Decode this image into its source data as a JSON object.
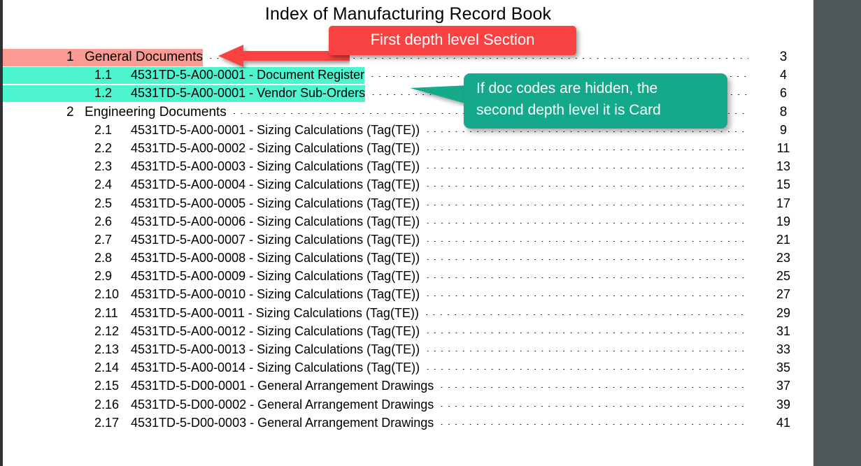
{
  "document": {
    "title": "Index of Manufacturing Record Book"
  },
  "toc": {
    "entries": [
      {
        "number": "1",
        "label": "General Documents",
        "page": "3",
        "level": 1,
        "highlight": "pink"
      },
      {
        "number": "1.1",
        "label": "4531TD-5-A00-0001 - Document Register",
        "page": "4",
        "level": 2,
        "highlight": "cyan"
      },
      {
        "number": "1.2",
        "label": "4531TD-5-A00-0001 - Vendor Sub-Orders",
        "page": "6",
        "level": 2,
        "highlight": "cyan"
      },
      {
        "number": "2",
        "label": "Engineering Documents",
        "page": "8",
        "level": 1,
        "highlight": "none"
      },
      {
        "number": "2.1",
        "label": "4531TD-5-A00-0001 - Sizing Calculations (Tag(TE))",
        "page": "9",
        "level": 2,
        "highlight": "none"
      },
      {
        "number": "2.2",
        "label": "4531TD-5-A00-0002 - Sizing Calculations (Tag(TE))",
        "page": "11",
        "level": 2,
        "highlight": "none"
      },
      {
        "number": "2.3",
        "label": "4531TD-5-A00-0003 - Sizing Calculations (Tag(TE))",
        "page": "13",
        "level": 2,
        "highlight": "none"
      },
      {
        "number": "2.4",
        "label": "4531TD-5-A00-0004 - Sizing Calculations (Tag(TE))",
        "page": "15",
        "level": 2,
        "highlight": "none"
      },
      {
        "number": "2.5",
        "label": "4531TD-5-A00-0005 - Sizing Calculations (Tag(TE))",
        "page": "17",
        "level": 2,
        "highlight": "none"
      },
      {
        "number": "2.6",
        "label": "4531TD-5-A00-0006 - Sizing Calculations (Tag(TE))",
        "page": "19",
        "level": 2,
        "highlight": "none"
      },
      {
        "number": "2.7",
        "label": "4531TD-5-A00-0007 - Sizing Calculations (Tag(TE))",
        "page": "21",
        "level": 2,
        "highlight": "none"
      },
      {
        "number": "2.8",
        "label": "4531TD-5-A00-0008 - Sizing Calculations (Tag(TE))",
        "page": "23",
        "level": 2,
        "highlight": "none"
      },
      {
        "number": "2.9",
        "label": "4531TD-5-A00-0009 - Sizing Calculations (Tag(TE))",
        "page": "25",
        "level": 2,
        "highlight": "none"
      },
      {
        "number": "2.10",
        "label": "4531TD-5-A00-0010 - Sizing Calculations (Tag(TE))",
        "page": "27",
        "level": 2,
        "highlight": "none"
      },
      {
        "number": "2.11",
        "label": "4531TD-5-A00-0011 - Sizing Calculations (Tag(TE))",
        "page": "29",
        "level": 2,
        "highlight": "none"
      },
      {
        "number": "2.12",
        "label": "4531TD-5-A00-0012 - Sizing Calculations (Tag(TE))",
        "page": "31",
        "level": 2,
        "highlight": "none"
      },
      {
        "number": "2.13",
        "label": "4531TD-5-A00-0013 - Sizing Calculations (Tag(TE))",
        "page": "33",
        "level": 2,
        "highlight": "none"
      },
      {
        "number": "2.14",
        "label": "4531TD-5-A00-0014 - Sizing Calculations (Tag(TE))",
        "page": "35",
        "level": 2,
        "highlight": "none"
      },
      {
        "number": "2.15",
        "label": "4531TD-5-D00-0001 - General Arrangement Drawings",
        "page": "37",
        "level": 2,
        "highlight": "none"
      },
      {
        "number": "2.16",
        "label": "4531TD-5-D00-0002 - General Arrangement Drawings",
        "page": "39",
        "level": 2,
        "highlight": "none"
      },
      {
        "number": "2.17",
        "label": "4531TD-5-D00-0003 - General Arrangement Drawings",
        "page": "41",
        "level": 2,
        "highlight": "none"
      }
    ]
  },
  "annotations": {
    "red": {
      "text": "First depth level Section",
      "color": "#f94343",
      "text_color": "#ffffff"
    },
    "green": {
      "line1": "If doc codes are hidden, the",
      "line2": "second depth level it is Card",
      "color": "#14a98a",
      "text_color": "#ffffff"
    }
  },
  "colors": {
    "highlight_pink": "#fb9a92",
    "highlight_cyan": "#4df5ce",
    "page_background": "#ffffff",
    "app_background": "#51585b"
  }
}
